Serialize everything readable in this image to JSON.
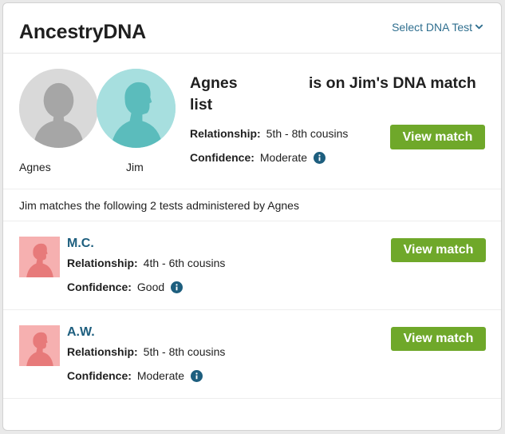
{
  "header": {
    "brand": "AncestryDNA",
    "select_test_label": "Select DNA Test"
  },
  "top_match": {
    "person_a_label": "Agnes",
    "person_b_label": "Jim",
    "headline_name": "Agnes",
    "headline_rest": "is on Jim's DNA match list",
    "relationship_key": "Relationship:",
    "relationship_value": "5th - 8th cousins",
    "confidence_key": "Confidence:",
    "confidence_value": "Moderate",
    "view_button": "View match"
  },
  "info_text": "Jim matches the following 2 tests administered by Agnes",
  "tests": [
    {
      "initials": "M.C.",
      "relationship_key": "Relationship:",
      "relationship_value": "4th - 6th cousins",
      "confidence_key": "Confidence:",
      "confidence_value": "Good",
      "view_button": "View match"
    },
    {
      "initials": "A.W.",
      "relationship_key": "Relationship:",
      "relationship_value": "5th - 8th cousins",
      "confidence_key": "Confidence:",
      "confidence_value": "Moderate",
      "view_button": "View match"
    }
  ],
  "icons": {
    "chevron": "chevron-down-icon",
    "info": "info-icon",
    "silhouette": "person-silhouette-icon"
  },
  "colors": {
    "brand_text": "#1f1f1f",
    "link": "#2f6f8f",
    "initials": "#1d5e7e",
    "button": "#6fa82a",
    "info_icon": "#1d5e7e",
    "agnes_avatar_bg": "#d9d9d9",
    "jim_avatar_bg": "#a7dfdf",
    "thumb_bg": "#f6b0b0"
  }
}
